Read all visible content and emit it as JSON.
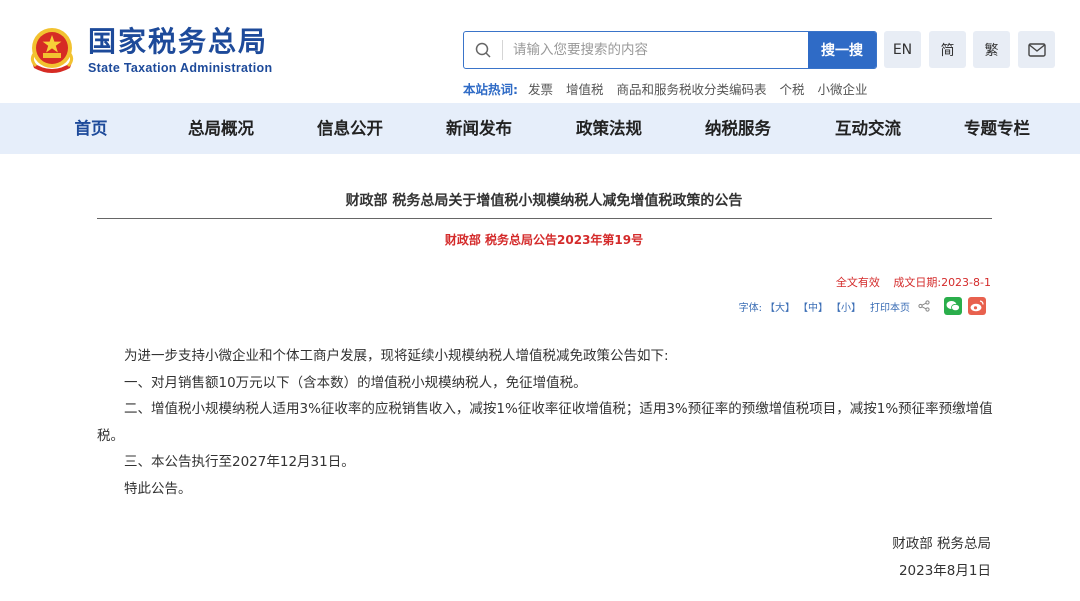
{
  "header": {
    "logo_cn": "国家税务总局",
    "logo_en": "State Taxation Administration",
    "search_placeholder": "请输入您要搜索的内容",
    "search_button": "搜一搜",
    "lang_en": "EN",
    "lang_simplified": "简",
    "lang_traditional": "繁",
    "hotwords_label": "本站热词:",
    "hotwords": [
      "发票",
      "增值税",
      "商品和服务税收分类编码表",
      "个税",
      "小微企业"
    ]
  },
  "nav": {
    "items": [
      "首页",
      "总局概况",
      "信息公开",
      "新闻发布",
      "政策法规",
      "纳税服务",
      "互动交流",
      "专题专栏"
    ],
    "active_index": 0
  },
  "article": {
    "title": "财政部 税务总局关于增值税小规模纳税人减免增值税政策的公告",
    "doc_number": "财政部 税务总局公告2023年第19号",
    "status": "全文有效",
    "date_label": "成文日期:2023-8-1",
    "tools": {
      "font_label": "字体:",
      "font_large": "【大】",
      "font_medium": "【中】",
      "font_small": "【小】",
      "print": "打印本页"
    },
    "paragraphs": [
      "为进一步支持小微企业和个体工商户发展，现将延续小规模纳税人增值税减免政策公告如下:",
      "一、对月销售额10万元以下（含本数）的增值税小规模纳税人，免征增值税。",
      "二、增值税小规模纳税人适用3%征收率的应税销售收入，减按1%征收率征收增值税；适用3%预征率的预缴增值税项目，减按1%预征率预缴增值税。",
      "三、本公告执行至2027年12月31日。",
      "特此公告。"
    ],
    "signature": "财政部 税务总局",
    "sign_date": "2023年8月1日"
  },
  "colors": {
    "brand_blue": "#1d4a9a",
    "search_blue": "#2f6bc6",
    "nav_bg": "#e6eefa",
    "alert_red": "#d42b2b",
    "wechat_green": "#2aae4b",
    "weibo_red": "#e8614e"
  }
}
